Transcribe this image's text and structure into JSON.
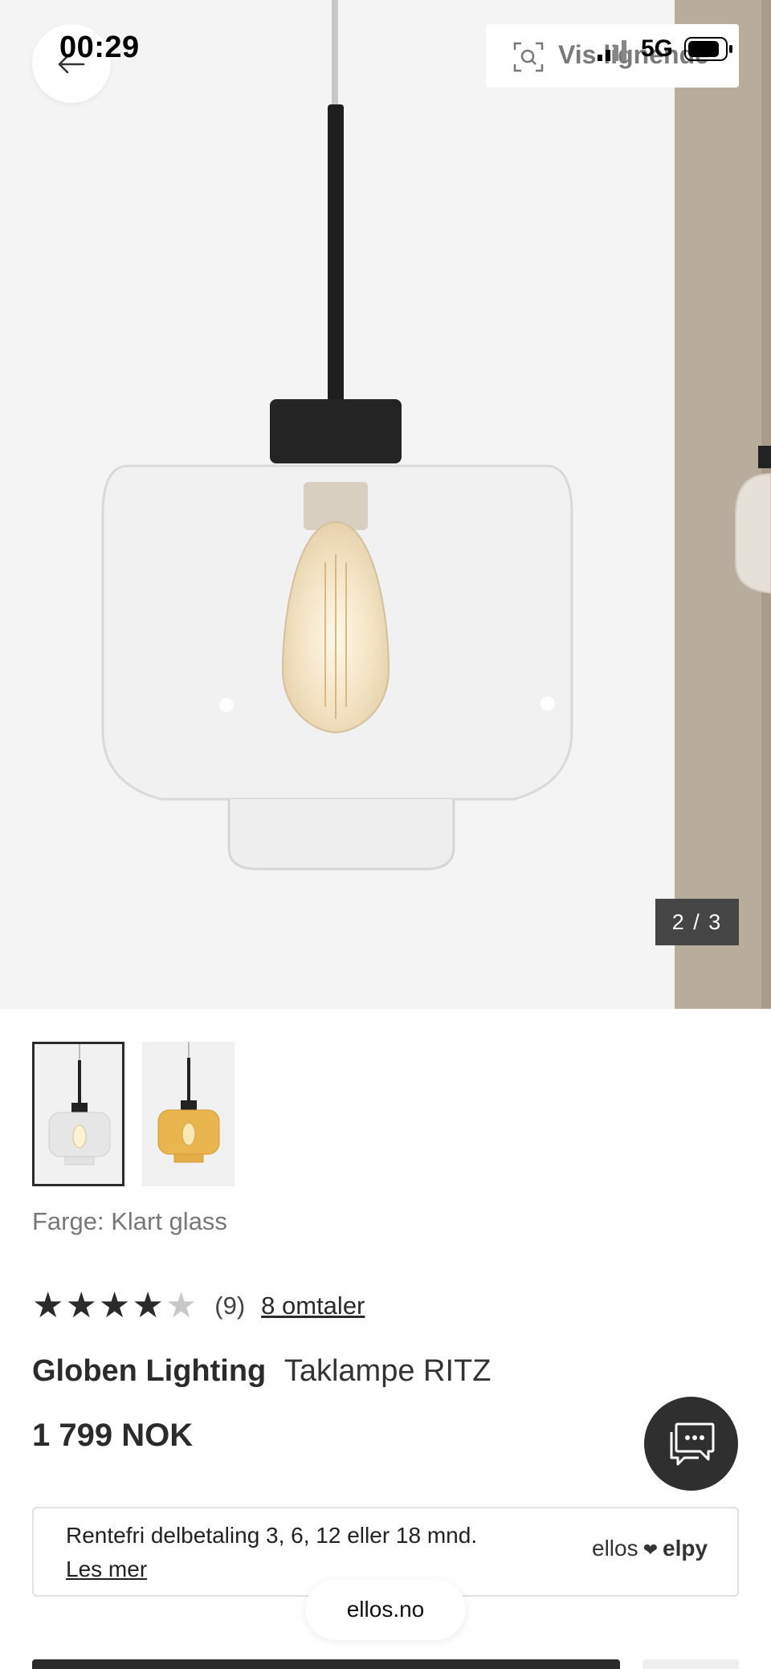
{
  "status_bar": {
    "time": "00:29",
    "network": "5G"
  },
  "hero": {
    "similar_label": "Vis lignende",
    "counter": "2 / 3"
  },
  "thumbnails": [
    {
      "label": "Klart glass",
      "selected": true,
      "glass_color": "#e9e9e9"
    },
    {
      "label": "Amber",
      "selected": false,
      "glass_color": "#e8b54f"
    }
  ],
  "product": {
    "color_label": "Farge: Klart glass",
    "rating": {
      "value": 4,
      "max": 5,
      "count": "(9)",
      "reviews_link": "8 omtaler"
    },
    "brand": "Globen Lighting",
    "name": "Taklampe RITZ",
    "price": "1 799 NOK"
  },
  "finance": {
    "text": "Rentefri delbetaling 3, 6, 12 eller 18 mnd.",
    "link": "Les mer",
    "logo_left": "ellos",
    "logo_right": "elpy"
  },
  "browser": {
    "url": "ellos.no"
  },
  "colors": {
    "dark": "#2b2b2b",
    "hero_bg": "#f4f4f4",
    "wall": "#b9ae9f"
  }
}
